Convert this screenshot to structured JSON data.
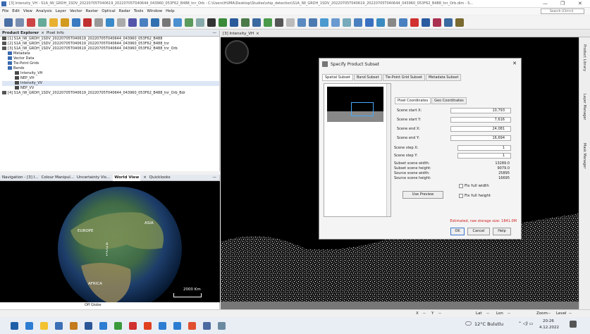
{
  "window_title": "[3] Intensity_VH - S1A_IW_GRDH_1SDV_20220705T040619_20220705T040644_043960_053F62_B488_tnr_Orb - C:\\Users\\HUMA\\Desktop\\Studies\\ship_detection\\S1A_IW_GRDH_1SDV_20220705T040619_20220705T040644_043960_053F62_B488_tnr_Orb.dim - S...",
  "window_controls": {
    "minimize": "—",
    "maximize": "❐",
    "close": "✕"
  },
  "menu": [
    "File",
    "Edit",
    "View",
    "Analysis",
    "Layer",
    "Vector",
    "Raster",
    "Optical",
    "Radar",
    "Tools",
    "Window",
    "Help"
  ],
  "search_placeholder": "Search (Ctrl+I)",
  "product_explorer": {
    "tab1": "Product Explorer",
    "tab2": "Pixel Info",
    "items": [
      "[1] S1A_IW_GRDH_1SDV_20220705T040619_20220705T040644_043960_053F62_B488",
      "[2] S1A_IW_GRDH_1SDV_20220705T040619_20220705T040644_043960_053F62_B488_tnr",
      "[3] S1A_IW_GRDH_1SDV_20220705T040619_20220705T040644_043960_053F62_B488_tnr_Orb",
      "Metadata",
      "Vector Data",
      "Tie-Point Grids",
      "Bands",
      "Intensity_VH",
      "NEP_VH",
      "Intensity_VV",
      "NEP_VV",
      "[4] S1A_IW_GRDH_1SDV_20220705T040619_20220705T040644_043960_053F62_B488_tnr_Orb_Bdr"
    ]
  },
  "bottom_tabs": [
    "Navigation - [3] I...",
    "Colour Manipul...",
    "Uncertainty Vis...",
    "World View",
    "Quicklooks"
  ],
  "globe": {
    "label_europe": "EUROPE",
    "label_asia": "ASIA",
    "label_africa": "AFRICA",
    "markers": "4\n3\n2\n1",
    "scale": "2000 Km",
    "footer": "Off Globe"
  },
  "image_tab": "[3] Intensity_VH",
  "right_side_tabs": [
    "Product Library",
    "Layer Manager",
    "Mask Manager"
  ],
  "dialog": {
    "title": "Specify Product Subset",
    "tabs": [
      "Spatial Subset",
      "Band Subset",
      "Tie-Point Grid Subset",
      "Metadata Subset"
    ],
    "subtabs": [
      "Pixel Coordinates",
      "Geo Coordinates"
    ],
    "fields": [
      {
        "label": "Scene start X:",
        "value": "10,793"
      },
      {
        "label": "Scene start Y:",
        "value": "7,616"
      },
      {
        "label": "Scene end X:",
        "value": "24,081"
      },
      {
        "label": "Scene end Y:",
        "value": "16,694"
      }
    ],
    "steps": [
      {
        "label": "Scene step X:",
        "value": "1"
      },
      {
        "label": "Scene step Y:",
        "value": "1"
      }
    ],
    "info": [
      {
        "label": "Subset scene width:",
        "value": "13289.0"
      },
      {
        "label": "Subset scene height:",
        "value": "9079.0"
      },
      {
        "label": "Source scene width:",
        "value": "25895"
      },
      {
        "label": "Source scene height:",
        "value": "16695"
      }
    ],
    "use_preview": "Use Preview",
    "fix_full_width": "Fix full width",
    "fix_full_height": "Fix full height",
    "estimate": "Estimated, raw storage size: 1841.0M",
    "ok": "OK",
    "cancel": "Cancel",
    "help": "Help",
    "close": "✕"
  },
  "status": {
    "x": "X",
    "y": "Y",
    "lat": "Lat",
    "lon": "Lon",
    "zoom": "Zoom",
    "level": "Level",
    "dash": "--"
  },
  "taskbar": {
    "weather": "12°C Bulutlu",
    "time": "20:26",
    "date": "4.12.2022"
  }
}
